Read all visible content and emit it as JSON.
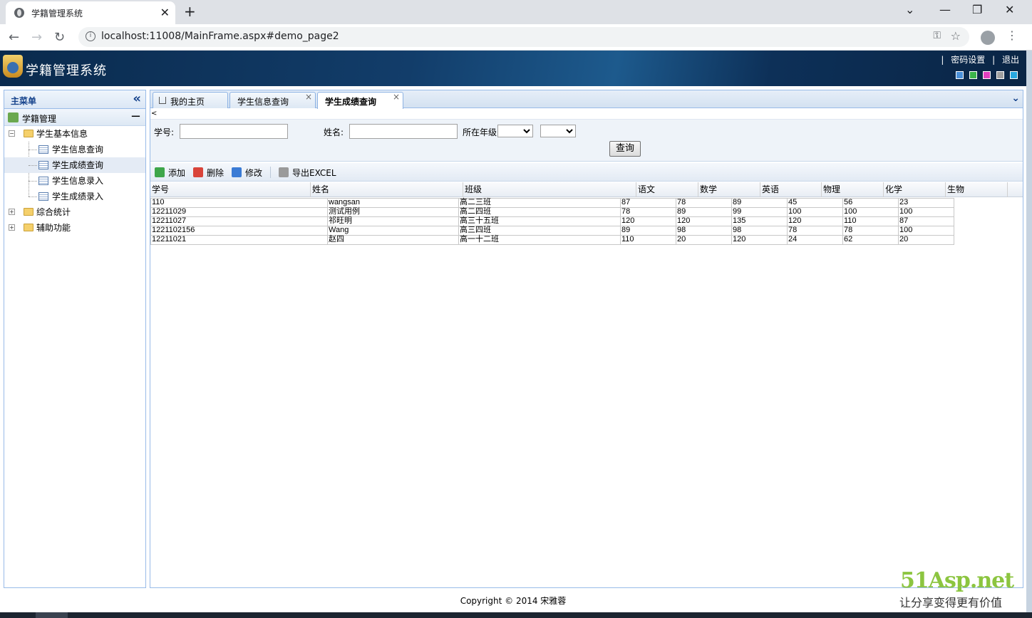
{
  "browser": {
    "tab_title": "学籍管理系统",
    "url": "localhost:11008/MainFrame.aspx#demo_page2"
  },
  "header": {
    "title": "学籍管理系统",
    "link_sep": "|",
    "password_link": "密码设置",
    "logout_link": "退出",
    "theme_colors": [
      "#4a90d9",
      "#3cb44b",
      "#e040c0",
      "#a0a0a0",
      "#29a8e0"
    ]
  },
  "sidebar": {
    "title": "主菜单",
    "section": "学籍管理",
    "tree": {
      "basic": "学生基本信息",
      "items": [
        "学生信息查询",
        "学生成绩查询",
        "学生信息录入",
        "学生成绩录入"
      ],
      "stats": "综合统计",
      "aux": "辅助功能"
    }
  },
  "tabs": [
    "我的主页",
    "学生信息查询",
    "学生成绩查询"
  ],
  "query": {
    "id_label": "学号:",
    "name_label": "姓名:",
    "grade_label": "所在年级",
    "button": "查询",
    "lt_char": "<"
  },
  "toolbar": {
    "add": "添加",
    "delete": "删除",
    "edit": "修改",
    "export": "导出EXCEL"
  },
  "grid": {
    "columns": [
      "学号",
      "姓名",
      "班级",
      "语文",
      "数学",
      "英语",
      "物理",
      "化学",
      "生物"
    ],
    "rows": [
      [
        "110",
        "wangsan",
        "高二三班",
        "87",
        "78",
        "89",
        "45",
        "56",
        "23"
      ],
      [
        "12211029",
        "测试用例",
        "高二四班",
        "78",
        "89",
        "99",
        "100",
        "100",
        "100"
      ],
      [
        "12211027",
        "祁旺明",
        "高三十五班",
        "120",
        "120",
        "135",
        "120",
        "110",
        "87"
      ],
      [
        "1221102156",
        "Wang",
        "高三四班",
        "89",
        "98",
        "98",
        "78",
        "78",
        "100"
      ],
      [
        "12211021",
        "赵四",
        "高一十二班",
        "110",
        "20",
        "120",
        "24",
        "62",
        "20"
      ]
    ]
  },
  "footer": "Copyright © 2014 宋雅蓉",
  "watermark": {
    "brand": "51Asp.net",
    "slogan": "让分享变得更有价值"
  }
}
